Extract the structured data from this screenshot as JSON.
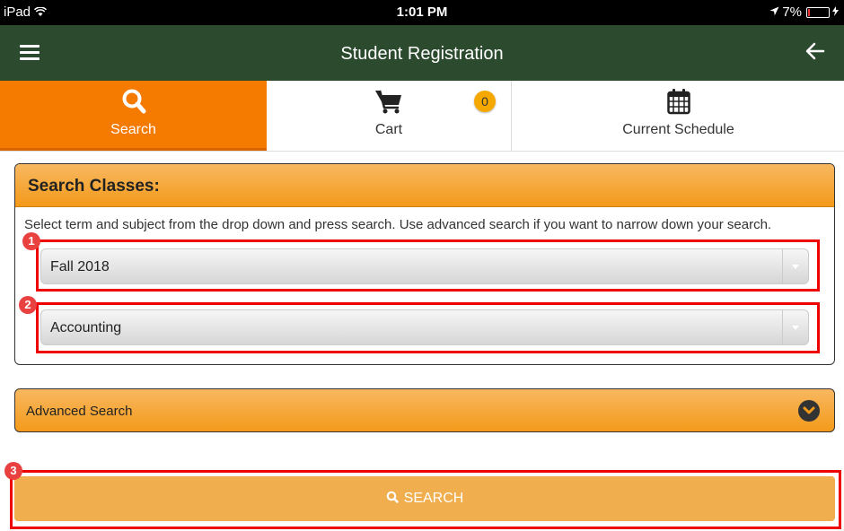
{
  "status_bar": {
    "device": "iPad",
    "time": "1:01 PM",
    "battery": "7%"
  },
  "header": {
    "title": "Student Registration",
    "menu_icon": "hamburger-menu-icon",
    "back_icon": "arrow-left-icon"
  },
  "tabs": [
    {
      "label": "Search",
      "icon": "search-icon",
      "active": true
    },
    {
      "label": "Cart",
      "icon": "cart-icon",
      "badge": "0"
    },
    {
      "label": "Current Schedule",
      "icon": "calendar-icon"
    }
  ],
  "search_card": {
    "title": "Search Classes:",
    "instructions": "Select term and subject from the drop down and press search. Use advanced search if you want to narrow down your search.",
    "term_select": {
      "value": "Fall 2018"
    },
    "subject_select": {
      "value": "Accounting"
    }
  },
  "annotations": [
    "1",
    "2",
    "3"
  ],
  "advanced_search": {
    "label": "Advanced Search"
  },
  "search_button": {
    "label": "SEARCH"
  },
  "colors": {
    "header_bg": "#2c4a2e",
    "active_tab": "#f47a00",
    "accent": "#f39a1a",
    "search_button": "#f0ae4e",
    "highlight": "#e00000"
  }
}
